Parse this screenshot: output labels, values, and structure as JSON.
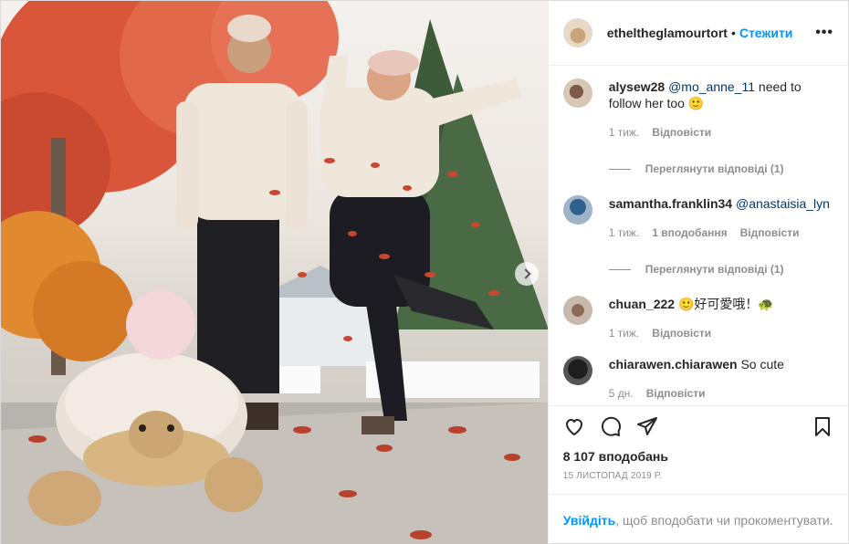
{
  "post": {
    "author": "ethel­theglamourtort",
    "separator": "•",
    "follow_label": "Стежити",
    "more_label": "•••",
    "colors": {
      "accent": "#0095f6",
      "mention": "#00376b",
      "muted": "#8e8e8e"
    }
  },
  "comments": [
    {
      "username": "alysew28",
      "mention": "@mo_anne_11",
      "text": " need to follow her too 🙂",
      "time": "1 тиж.",
      "likes": "",
      "reply_label": "Відповісти",
      "view_replies": "Переглянути відповіді (1)"
    },
    {
      "username": "samantha.franklin34",
      "mention": "@anastaisia_lyn",
      "text": "",
      "time": "1 тиж.",
      "likes": "1 вподобання",
      "reply_label": "Відповісти",
      "view_replies": "Переглянути відповіді (1)"
    },
    {
      "username": "chuan_222",
      "mention": "",
      "text": "🙂好可愛哦！🐢",
      "time": "1 тиж.",
      "likes": "",
      "reply_label": "Відповісти",
      "view_replies": ""
    },
    {
      "username": "chiarawen.chiarawen",
      "mention": "",
      "text": "So cute",
      "time": "5 дн.",
      "likes": "",
      "reply_label": "Відповісти",
      "view_replies": ""
    }
  ],
  "actions": {
    "like_icon": "heart-icon",
    "comment_icon": "comment-icon",
    "share_icon": "share-icon",
    "save_icon": "bookmark-icon"
  },
  "likes_count": "8 107 вподобань",
  "date": "15 листопад 2019 р.",
  "login_bar": {
    "login_label": "Увійдіть",
    "rest_text": ", щоб вподобати чи прокоментувати."
  }
}
